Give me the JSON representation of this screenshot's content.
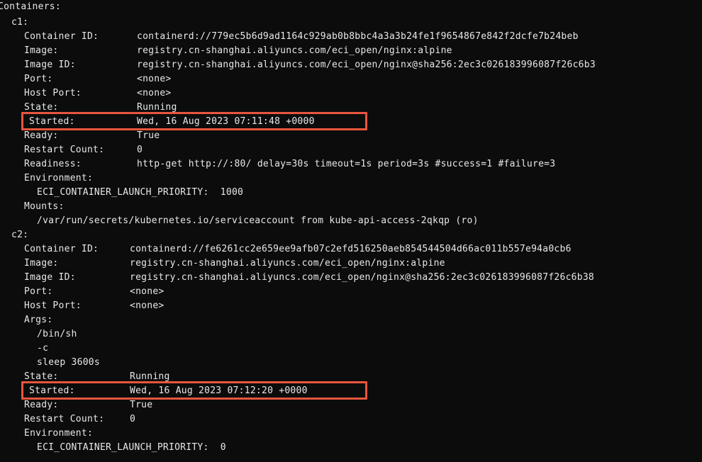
{
  "terminal": {
    "background_color": "#0c0c0c",
    "text_color": "#e8e8e8",
    "highlight_color": "#e8553d",
    "root_label": "Containers:",
    "containers": [
      {
        "name": "c1:",
        "fields": [
          {
            "label": "Container ID:",
            "value": "containerd://779ec5b6d9ad1164c929ab0b8bbc4a3a3b24fe1f9654867e842f2dcfe7b24beb"
          },
          {
            "label": "Image:",
            "value": "registry.cn-shanghai.aliyuncs.com/eci_open/nginx:alpine"
          },
          {
            "label": "Image ID:",
            "value": "registry.cn-shanghai.aliyuncs.com/eci_open/nginx@sha256:2ec3c026183996087f26c6b3"
          },
          {
            "label": "Port:",
            "value": "<none>"
          },
          {
            "label": "Host Port:",
            "value": "<none>"
          },
          {
            "label": "State:",
            "value": "Running"
          },
          {
            "label": "Started:",
            "value": "Wed, 16 Aug 2023 07:11:48 +0000"
          },
          {
            "label": "Ready:",
            "value": "True"
          },
          {
            "label": "Restart Count:",
            "value": "0"
          },
          {
            "label": "Readiness:",
            "value": "http-get http://:80/ delay=30s timeout=1s period=3s #success=1 #failure=3"
          },
          {
            "label": "Environment:",
            "value": ""
          }
        ],
        "environment_entries": [
          "ECI_CONTAINER_LAUNCH_PRIORITY:  1000"
        ],
        "mounts_label": "Mounts:",
        "mounts_entries": [
          "/var/run/secrets/kubernetes.io/serviceaccount from kube-api-access-2qkqp (ro)"
        ]
      },
      {
        "name": "c2:",
        "fields": [
          {
            "label": "Container ID:",
            "value": "containerd://fe6261cc2e659ee9afb07c2efd516250aeb854544504d66ac011b557e94a0cb6"
          },
          {
            "label": "Image:",
            "value": "registry.cn-shanghai.aliyuncs.com/eci_open/nginx:alpine"
          },
          {
            "label": "Image ID:",
            "value": "registry.cn-shanghai.aliyuncs.com/eci_open/nginx@sha256:2ec3c026183996087f26c6b38"
          },
          {
            "label": "Port:",
            "value": "<none>"
          },
          {
            "label": "Host Port:",
            "value": "<none>"
          },
          {
            "label": "Args:",
            "value": ""
          }
        ],
        "args_entries": [
          "/bin/sh",
          "-c",
          "sleep 3600s"
        ],
        "fields2": [
          {
            "label": "State:",
            "value": "Running"
          },
          {
            "label": "Started:",
            "value": "Wed, 16 Aug 2023 07:12:20 +0000"
          },
          {
            "label": "Ready:",
            "value": "True"
          },
          {
            "label": "Restart Count:",
            "value": "0"
          },
          {
            "label": "Environment:",
            "value": ""
          }
        ],
        "environment_entries": [
          "ECI_CONTAINER_LAUNCH_PRIORITY:  0"
        ]
      }
    ],
    "highlights": [
      {
        "id": "started-c1",
        "text": "Started:         Wed, 16 Aug 2023 07:11:48 +0000"
      },
      {
        "id": "started-c2",
        "text": "Started:         Wed, 16 Aug 2023 07:12:20 +0000"
      }
    ]
  }
}
